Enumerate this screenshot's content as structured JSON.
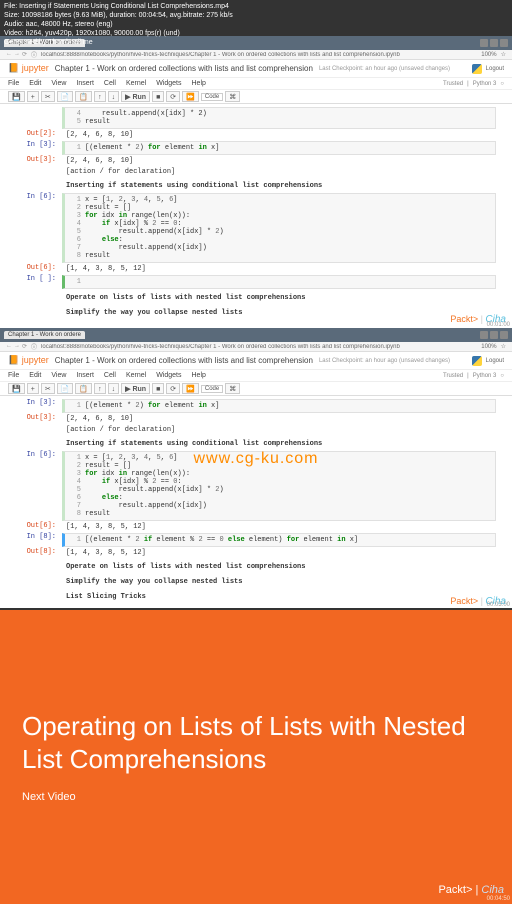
{
  "meta": {
    "file": "File: Inserting if Statements Using Conditional List Comprehensions.mp4",
    "size": "Size: 10098186 bytes (9.63 MiB), duration: 00:04:54, avg.bitrate: 275 kb/s",
    "audio": "Audio: aac, 48000 Hz, stereo (eng)",
    "video": "Video: h264, yuv420p, 1920x1080, 90000.00 fps(r) (und)",
    "gen": "Generated by Thumbnail me"
  },
  "browser": {
    "tab": "Chapter 1 - Work on ordere",
    "url": "localhost:8888/notebooks/python/hive-tricks-techniques/Chapter 1 - Work on ordered collections with lists and list comprehension.ipynb",
    "zoom": "100%"
  },
  "jupyter": {
    "logo": "jupyter",
    "title": "Chapter 1 - Work on ordered collections with lists and list comprehension",
    "checkpoint": "Last Checkpoint: an hour ago (unsaved changes)",
    "logout": "Logout",
    "trusted": "Trusted",
    "kernel": "Python 3",
    "menus": [
      "File",
      "Edit",
      "View",
      "Insert",
      "Cell",
      "Kernel",
      "Widgets",
      "Help"
    ],
    "tb": {
      "save": "💾",
      "plus": "+",
      "cut": "✂",
      "copy": "📄",
      "paste": "📋",
      "up": "↑",
      "down": "↓",
      "run": "▶ Run",
      "stop": "■",
      "restart": "⟳",
      "fwd": "⏩",
      "dd": "Code",
      "cmd": "⌘"
    }
  },
  "pane1": {
    "l0": "result.append(x[idx] * 2)",
    "l0b": "result",
    "out2": "[2, 4, 6, 8, 10]",
    "in3": "[(element * 2) for element in x]",
    "out3": "[2, 4, 6, 8, 10]",
    "syn": "[action / for declaration]",
    "hd1": "Inserting if statements using conditional list comprehensions",
    "in6_1": "x = [1, 2, 3, 4, 5, 6]",
    "in6_2": "result = []",
    "in6_3": "for idx in range(len(x)):",
    "in6_4": "    if x[idx] % 2 == 0:",
    "in6_5": "        result.append(x[idx] * 2)",
    "in6_6": "    else:",
    "in6_7": "        result.append(x[idx])",
    "in6_8": "result",
    "out6": "[1, 4, 3, 8, 5, 12]",
    "hd2": "Operate on lists of lists with nested list comprehensions",
    "hd3": "Simplify the way you collapse nested lists"
  },
  "pane2": {
    "in3": "[(element * 2) for element in x]",
    "out3": "[2, 4, 6, 8, 10]",
    "syn": "[action / for declaration]",
    "hd1": "Inserting if statements using conditional list comprehensions",
    "in6_1": "x = [1, 2, 3, 4, 5, 6]",
    "in6_2": "result = []",
    "in6_3": "for idx in range(len(x)):",
    "in6_4": "    if x[idx] % 2 == 0:",
    "in6_5": "        result.append(x[idx] * 2)",
    "in6_6": "    else:",
    "in6_7": "        result.append(x[idx])",
    "in6_8": "result",
    "out6": "[1, 4, 3, 8, 5, 12]",
    "in8": "[(element * 2 if element % 2 == 0 else element) for element in x]",
    "out8": "[1, 4, 3, 8, 5, 12]",
    "hd2": "Operate on lists of lists with nested list comprehensions",
    "hd3": "Simplify the way you collapse nested lists",
    "hd4": "List Slicing Tricks"
  },
  "watermark": "www.cg-ku.com",
  "packt": "Packt>",
  "times": {
    "t1": "00:01:00",
    "t2": "00:03:00",
    "t3": "00:04:50"
  },
  "orange": {
    "title": "Operating on Lists of Lists with Nested List Comprehensions",
    "next": "Next Video"
  }
}
